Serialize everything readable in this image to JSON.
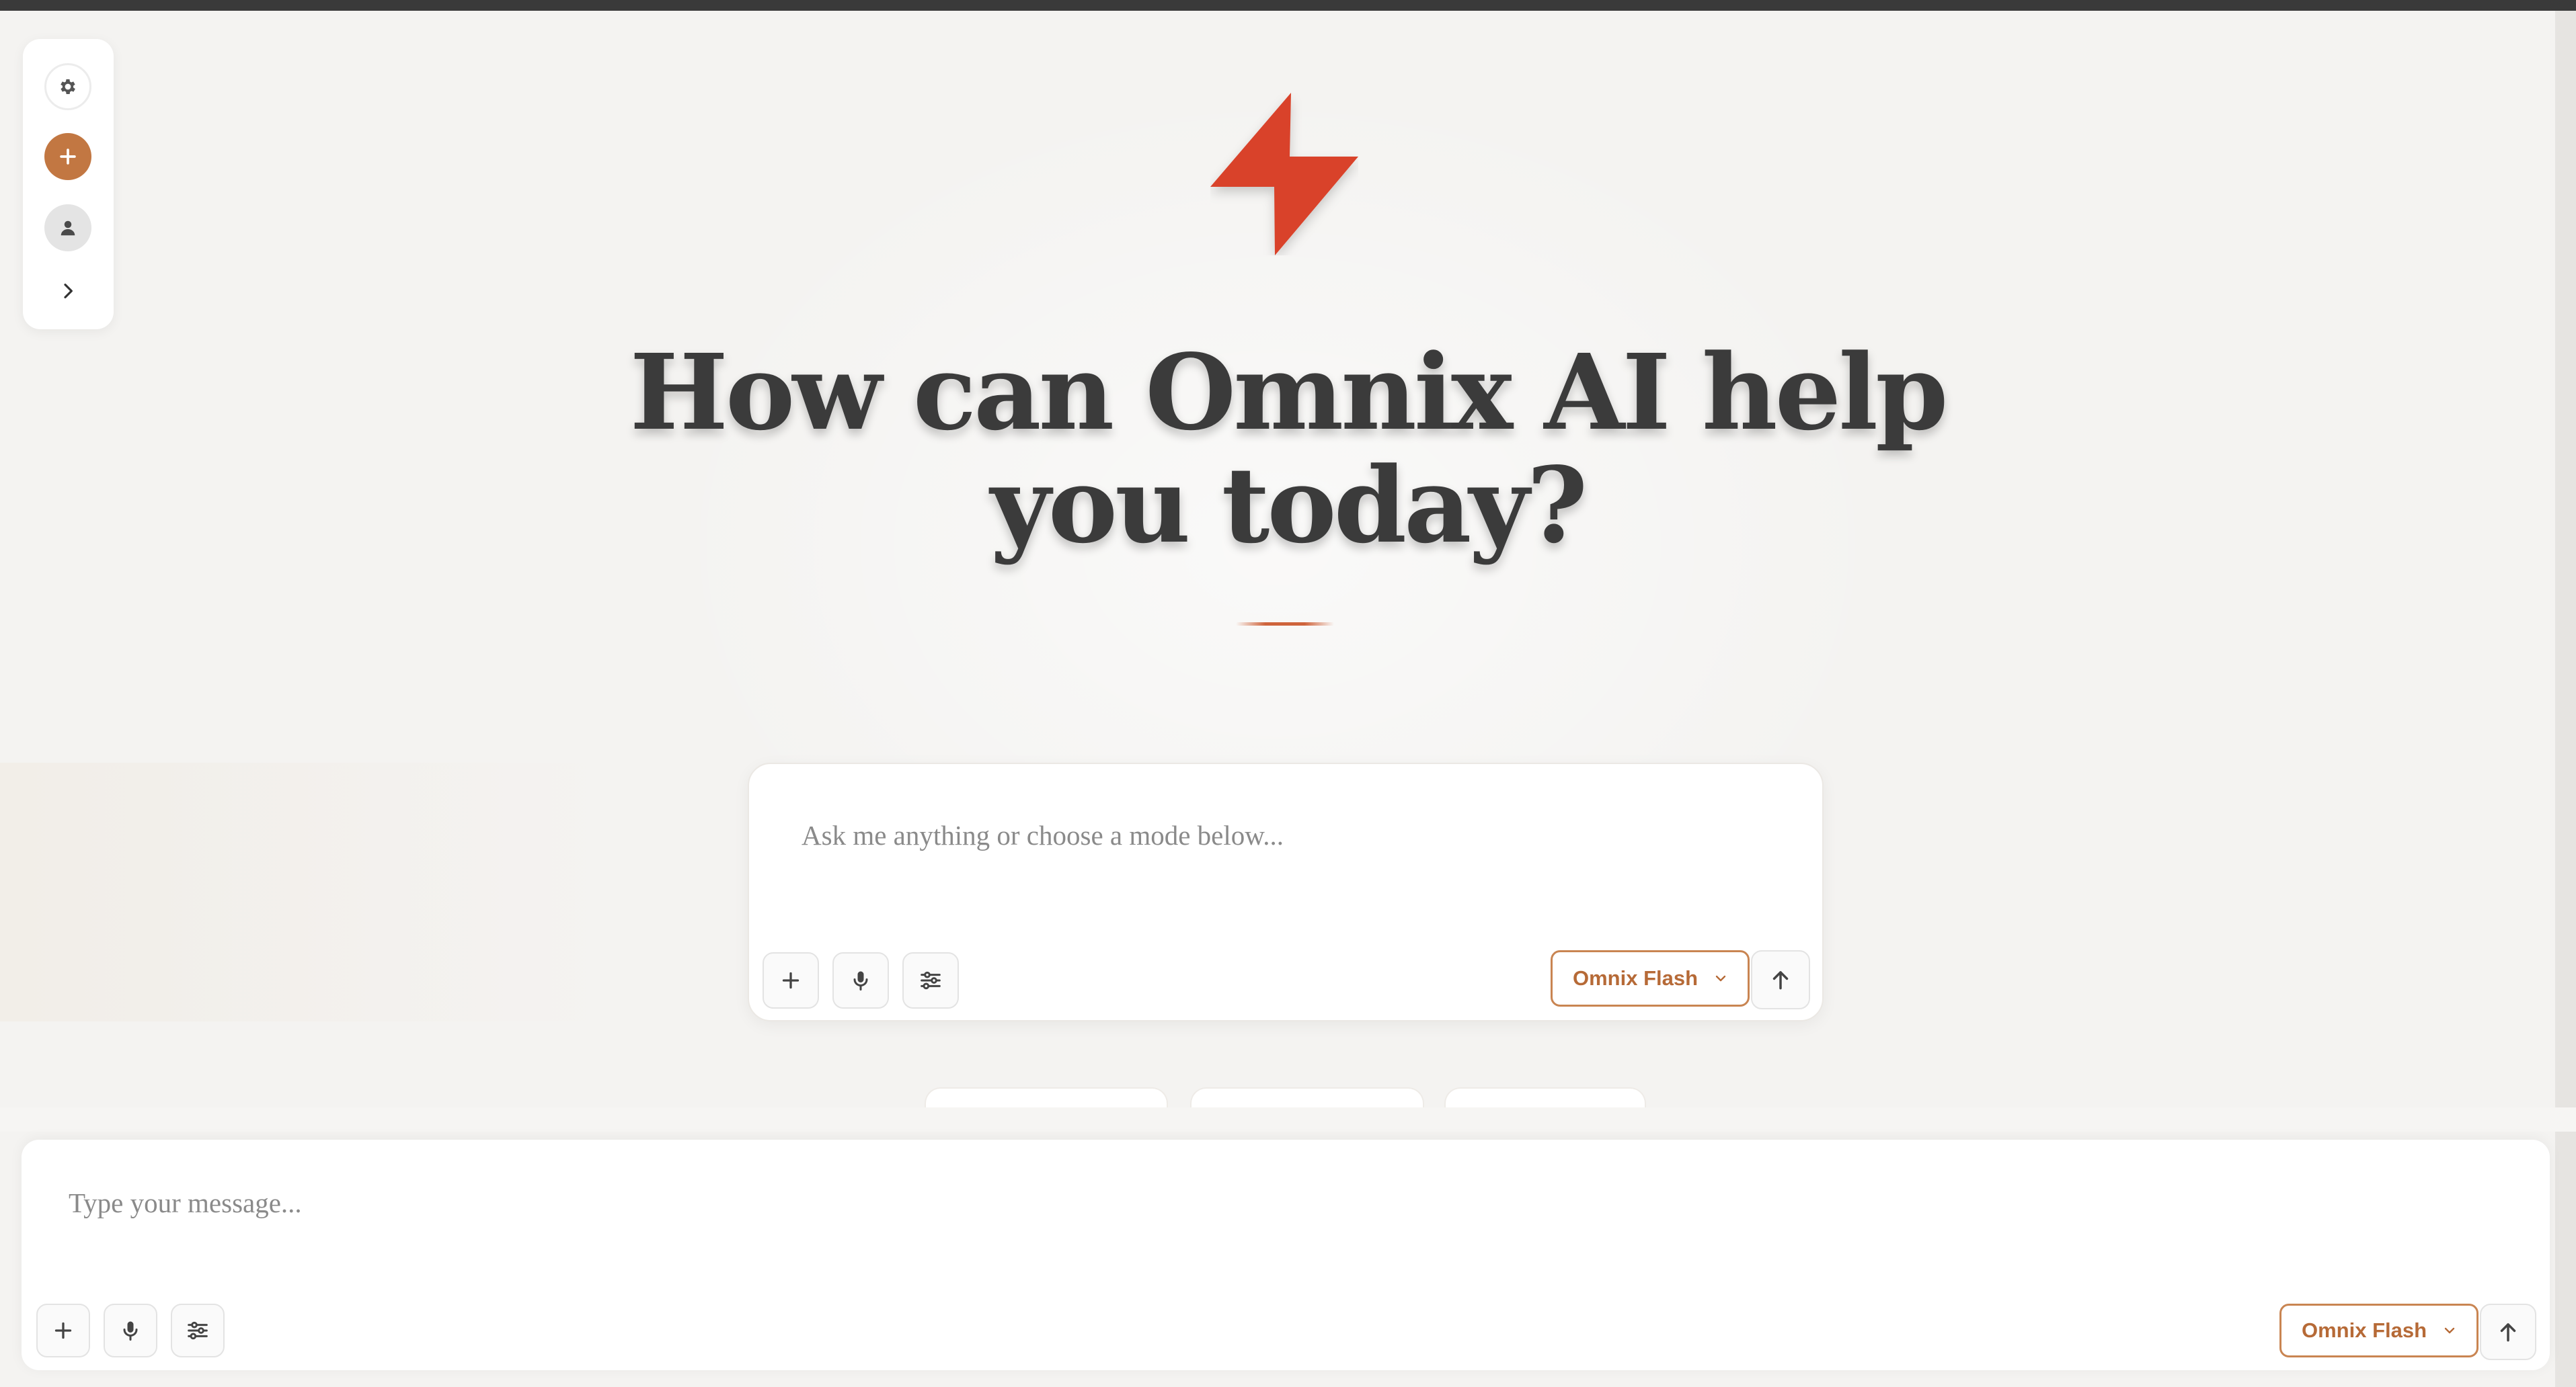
{
  "app": {
    "hero_title": "How can Omnix AI help you today?",
    "brand_color": "#d9432a",
    "accent_color": "#c27742"
  },
  "sidebar": {
    "items": [
      {
        "name": "settings",
        "icon": "gear-icon"
      },
      {
        "name": "new-chat",
        "icon": "plus-icon"
      },
      {
        "name": "profile",
        "icon": "user-icon"
      },
      {
        "name": "expand",
        "icon": "chevron-right-icon"
      }
    ]
  },
  "composer": {
    "placeholder": "Ask me anything or choose a mode below...",
    "value": "",
    "model_label": "Omnix Flash",
    "tools": [
      "plus-icon",
      "microphone-icon",
      "sliders-icon"
    ],
    "send_icon": "arrow-up-icon"
  },
  "mode_chips": [
    {
      "label": ""
    },
    {
      "label": ""
    },
    {
      "label": ""
    }
  ],
  "bottom_bar": {
    "placeholder": "Type your message...",
    "value": "",
    "model_label": "Omnix Flash",
    "tools": [
      "plus-icon",
      "microphone-icon",
      "sliders-icon"
    ],
    "send_icon": "arrow-up-icon"
  }
}
